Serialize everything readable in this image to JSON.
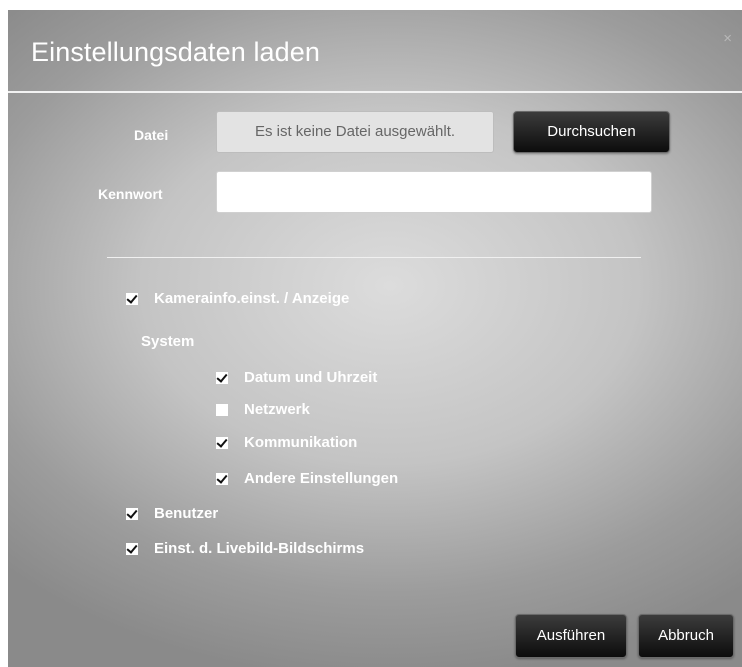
{
  "dialog": {
    "title": "Einstellungsdaten laden",
    "close_symbol": "×"
  },
  "form": {
    "file_label": "Datei",
    "file_value": "Es ist keine Datei ausgewählt.",
    "browse_label": "Durchsuchen",
    "password_label": "Kennwort",
    "password_value": ""
  },
  "options": {
    "camera_info": {
      "label": "Kamerainfo.einst. / Anzeige",
      "checked": true
    },
    "system_heading": "System",
    "system_items": [
      {
        "label": "Datum und Uhrzeit",
        "checked": true
      },
      {
        "label": "Netzwerk",
        "checked": false
      },
      {
        "label": "Kommunikation",
        "checked": true
      },
      {
        "label": "Andere Einstellungen",
        "checked": true
      }
    ],
    "users": {
      "label": "Benutzer",
      "checked": true
    },
    "liveview": {
      "label": "Einst. d. Livebild-Bildschirms",
      "checked": true
    }
  },
  "footer": {
    "execute_label": "Ausführen",
    "cancel_label": "Abbruch"
  },
  "icons": {
    "close": "close-icon",
    "checkbox": "checkbox-icon"
  },
  "colors": {
    "text": "#ffffff",
    "button_bg": "#111111",
    "file_field_bg": "#e3e3e3"
  }
}
